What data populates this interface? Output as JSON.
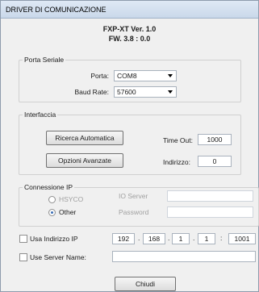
{
  "window": {
    "title": "DRIVER DI COMUNICAZIONE"
  },
  "header": {
    "version": "FXP-XT Ver. 1.0",
    "firmware": "FW. 3.8 : 0.0"
  },
  "serial": {
    "legend": "Porta Seriale",
    "port_label": "Porta:",
    "port_value": "COM8",
    "baud_label": "Baud Rate:",
    "baud_value": "57600"
  },
  "interface": {
    "legend": "Interfaccia",
    "auto_search_label": "Ricerca Automatica",
    "advanced_label": "Opzioni Avanzate",
    "timeout_label": "Time Out:",
    "timeout_value": "1000",
    "address_label": "Indirizzo:",
    "address_value": "0"
  },
  "ip": {
    "legend": "Connessione IP",
    "radio_hsyco": "HSYCO",
    "radio_other": "Other",
    "selected": "Other",
    "io_server_label": "IO Server",
    "password_label": "Password",
    "use_ip_label": "Usa Indirizzo IP",
    "ip_octets": [
      "192",
      "168",
      "1",
      "1"
    ],
    "ip_port": "1001",
    "use_server_label": "Use Server Name:"
  },
  "footer": {
    "close_label": "Chiudi"
  }
}
